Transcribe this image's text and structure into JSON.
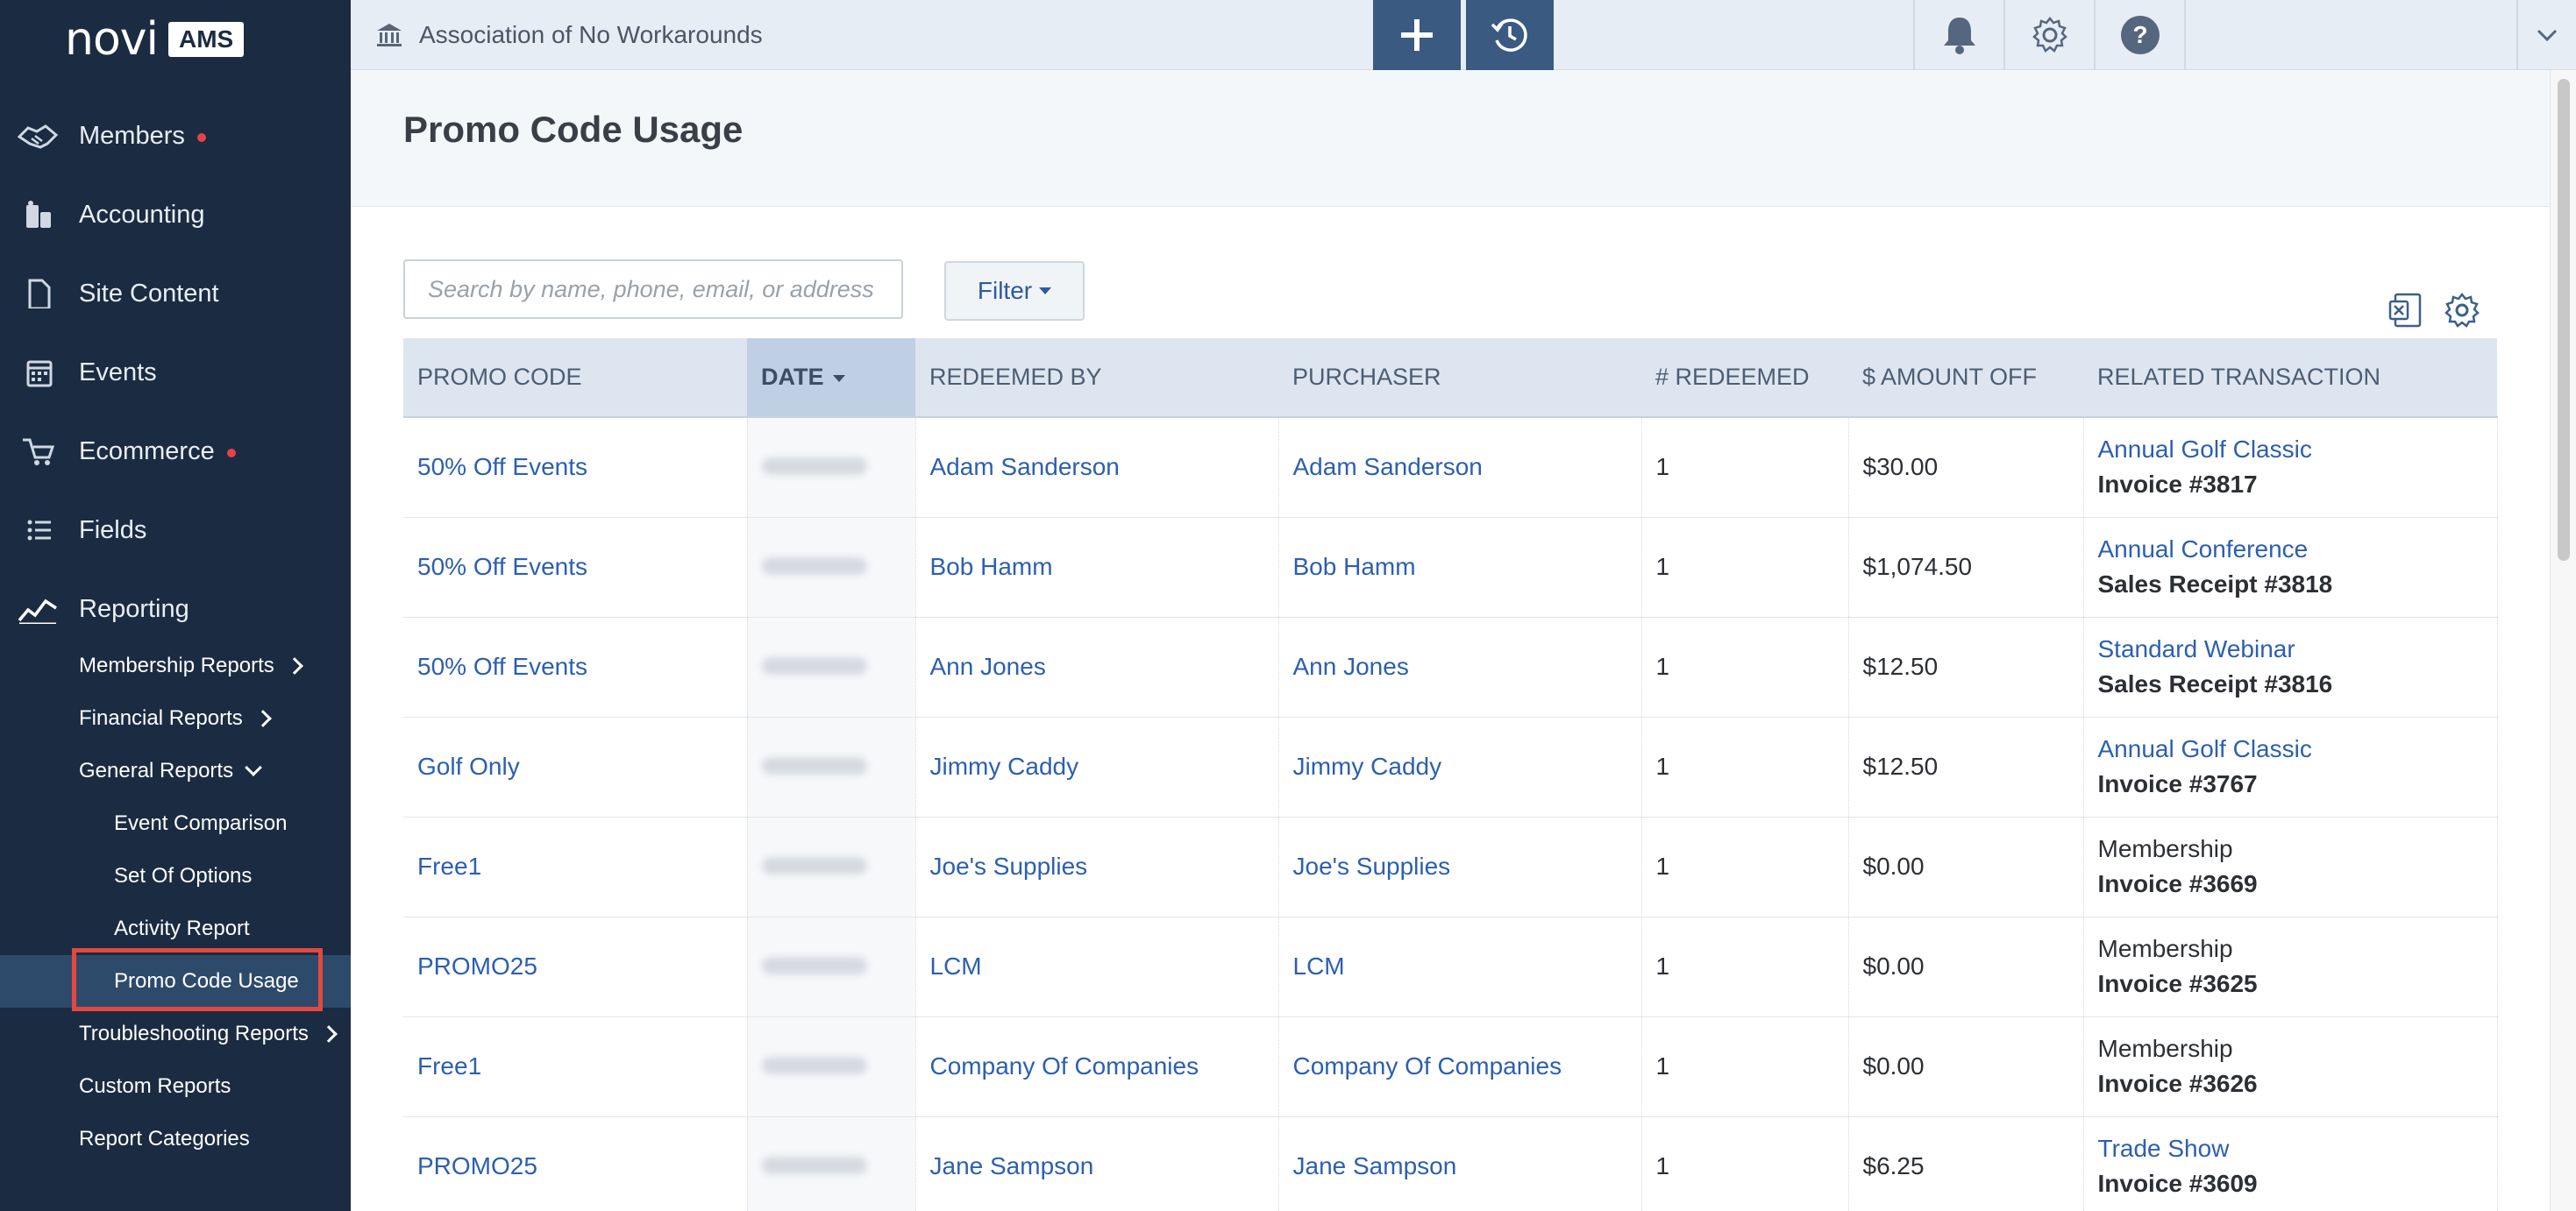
{
  "brand": {
    "logo_text": "novi",
    "logo_badge": "AMS"
  },
  "sidebar": {
    "items": [
      {
        "label": "Members",
        "icon": "handshake-icon",
        "dot": true
      },
      {
        "label": "Accounting",
        "icon": "calculator-icon",
        "dot": false
      },
      {
        "label": "Site Content",
        "icon": "document-icon",
        "dot": false
      },
      {
        "label": "Events",
        "icon": "calendar-icon",
        "dot": false
      },
      {
        "label": "Ecommerce",
        "icon": "cart-icon",
        "dot": true
      },
      {
        "label": "Fields",
        "icon": "list-icon",
        "dot": false
      },
      {
        "label": "Reporting",
        "icon": "chart-icon",
        "dot": false
      }
    ],
    "reporting_sub": [
      {
        "label": "Membership Reports",
        "chevron": "right"
      },
      {
        "label": "Financial Reports",
        "chevron": "right"
      },
      {
        "label": "General Reports",
        "chevron": "down"
      },
      {
        "label": "Event Comparison"
      },
      {
        "label": "Set Of Options"
      },
      {
        "label": "Activity Report"
      },
      {
        "label": "Promo Code Usage",
        "active": true
      },
      {
        "label": "Troubleshooting Reports",
        "chevron": "right"
      },
      {
        "label": "Custom Reports"
      },
      {
        "label": "Report Categories"
      }
    ]
  },
  "topbar": {
    "org_name": "Association of No Workarounds",
    "icons": [
      "plus-icon",
      "history-icon",
      "bell-icon",
      "gear-icon",
      "help-icon",
      "chevron-down-icon"
    ]
  },
  "page": {
    "title": "Promo Code Usage"
  },
  "search": {
    "placeholder": "Search by name, phone, email, or address"
  },
  "filter": {
    "label": "Filter"
  },
  "table": {
    "columns": [
      "PROMO CODE",
      "DATE",
      "REDEEMED BY",
      "PURCHASER",
      "# REDEEMED",
      "$ AMOUNT OFF",
      "RELATED TRANSACTION"
    ],
    "sorted_column": "DATE",
    "rows": [
      {
        "promo": "50% Off Events",
        "redeemed_by": "Adam Sanderson",
        "purchaser": "Adam Sanderson",
        "count": "1",
        "amount": "$30.00",
        "tx_title": "Annual Golf Classic",
        "tx_link": true,
        "tx_ref": "Invoice #3817"
      },
      {
        "promo": "50% Off Events",
        "redeemed_by": "Bob Hamm",
        "purchaser": "Bob Hamm",
        "count": "1",
        "amount": "$1,074.50",
        "tx_title": "Annual Conference",
        "tx_link": true,
        "tx_ref": "Sales Receipt #3818"
      },
      {
        "promo": "50% Off Events",
        "redeemed_by": "Ann Jones",
        "purchaser": "Ann Jones",
        "count": "1",
        "amount": "$12.50",
        "tx_title": "Standard Webinar",
        "tx_link": true,
        "tx_ref": "Sales Receipt #3816"
      },
      {
        "promo": "Golf Only",
        "redeemed_by": "Jimmy Caddy",
        "purchaser": "Jimmy Caddy",
        "count": "1",
        "amount": "$12.50",
        "tx_title": "Annual Golf Classic",
        "tx_link": true,
        "tx_ref": "Invoice #3767"
      },
      {
        "promo": "Free1",
        "redeemed_by": "Joe's Supplies",
        "purchaser": "Joe's Supplies",
        "count": "1",
        "amount": "$0.00",
        "tx_title": "Membership",
        "tx_link": false,
        "tx_ref": "Invoice #3669"
      },
      {
        "promo": "PROMO25",
        "redeemed_by": "LCM",
        "purchaser": "LCM",
        "count": "1",
        "amount": "$0.00",
        "tx_title": "Membership",
        "tx_link": false,
        "tx_ref": "Invoice #3625"
      },
      {
        "promo": "Free1",
        "redeemed_by": "Company Of Companies",
        "purchaser": "Company Of Companies",
        "count": "1",
        "amount": "$0.00",
        "tx_title": "Membership",
        "tx_link": false,
        "tx_ref": "Invoice #3626"
      },
      {
        "promo": "PROMO25",
        "redeemed_by": "Jane Sampson",
        "purchaser": "Jane Sampson",
        "count": "1",
        "amount": "$6.25",
        "tx_title": "Trade Show",
        "tx_link": true,
        "tx_ref": "Invoice #3609"
      }
    ]
  },
  "colors": {
    "sidebar_bg": "#1b2b42",
    "accent": "#3a5a82",
    "link": "#2c5fb0",
    "highlight": "#e4483f",
    "alert_dot": "#e8414a"
  }
}
